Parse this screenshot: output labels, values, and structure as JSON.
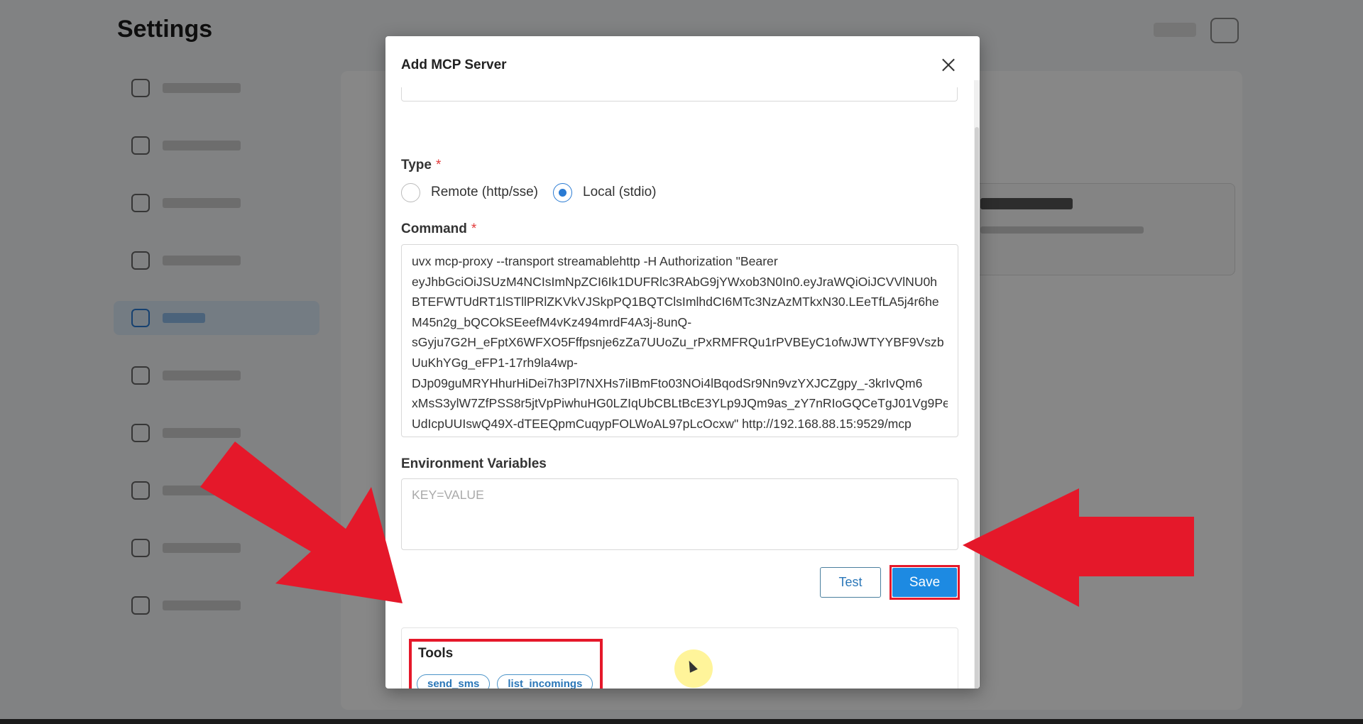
{
  "background": {
    "title": "Settings"
  },
  "modal": {
    "title": "Add MCP Server",
    "type_label": "Type",
    "required_mark": "*",
    "type_options": [
      {
        "label": "Remote (http/sse)",
        "selected": false
      },
      {
        "label": "Local (stdio)",
        "selected": true
      }
    ],
    "command_label": "Command",
    "command_lines": [
      "uvx mcp-proxy --transport streamablehttp -H Authorization \"Bearer",
      "eyJhbGciOiJSUzM4NCIsImNpZCI6Ik1DUFRlc3RAbG9jYWxob3N0In0.eyJraWQiOiJCVVlNU0h",
      "BTEFWTUdRT1lSTllPRlZKVkVJSkpPQ1BQTClsImlhdCI6MTc3NzAzMTkxN30.LEeTfLA5j4r6he",
      "M45n2g_bQCOkSEeefM4vKz494mrdF4A3j-8unQ-",
      "sGyju7G2H_eFptX6WFXO5Fffpsnje6zZa7UUoZu_rPxRMFRQu1rPVBEyC1ofwJWTYYBF9Vszb",
      "UuKhYGg_eFP1-17rh9la4wp-",
      "DJp09guMRYHhurHiDei7h3Pl7NXHs7iIBmFto03NOi4lBqodSr9Nn9vzYXJCZgpy_-3krIvQm6",
      "xMsS3ylW7ZfPSS8r5jtVpPiwhuHG0LZIqUbCBLtBcE3YLp9JQm9as_zY7nRIoGQCeTgJ01Vg9Pe",
      "UdIcpUUIswQ49X-dTEEQpmCuqypFOLWoAL97pLcOcxw\" http://192.168.88.15:9529/mcp"
    ],
    "env_label": "Environment Variables",
    "env_placeholder": "KEY=VALUE",
    "test_label": "Test",
    "save_label": "Save",
    "tools_title": "Tools",
    "tools": [
      "send_sms",
      "list_incomings"
    ]
  },
  "annotations": {
    "arrow_color": "#e5182a"
  }
}
